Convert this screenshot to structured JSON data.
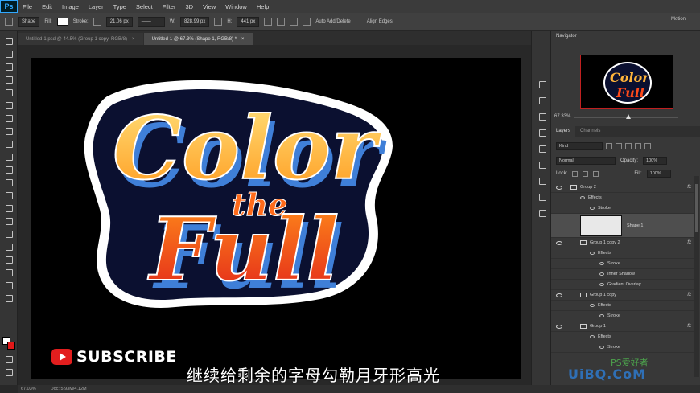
{
  "menu": {
    "app_logo": "Ps",
    "items": [
      "File",
      "Edit",
      "Image",
      "Layer",
      "Type",
      "Select",
      "Filter",
      "3D",
      "View",
      "Window",
      "Help"
    ]
  },
  "options": {
    "mode": "Shape",
    "fill_label": "Fill:",
    "stroke_label": "Stroke:",
    "stroke_width": "21.06 px",
    "width_label": "W:",
    "width_value": "828.99 px",
    "height_label": "H:",
    "height_value": "441 px",
    "auto_add_delete": "Auto Add/Delete",
    "align_edges": "Align Edges",
    "workspace": "Motion"
  },
  "tabs": [
    {
      "label": "Untitled-1.psd @ 44.5% (Group 1 copy, RGB/8)",
      "close": "×"
    },
    {
      "label": "Untitled-1 @ 67.3% (Shape 1, RGB/8) *",
      "close": "×"
    }
  ],
  "artwork": {
    "line1": "Color",
    "line2": "the",
    "line3": "Full",
    "colors": {
      "outline": "#ffffff",
      "dark": "#0b1030",
      "blue": "#3f7fd8",
      "orange": "#ff8a1a",
      "yellow": "#ffd45a",
      "red": "#e8321a"
    }
  },
  "navigator": {
    "title": "Navigator",
    "zoom": "67.33%",
    "preview_line1": "Color",
    "preview_line2": "Full",
    "zoom_fraction": 0.52
  },
  "layers_panel": {
    "tabs": [
      "Layers",
      "Channels"
    ],
    "filter_kind": "Kind",
    "blend_mode": "Normal",
    "opacity_label": "Opacity:",
    "opacity": "100%",
    "lock_label": "Lock:",
    "fill_label": "Fill:",
    "fill": "100%",
    "layers": [
      {
        "name": "Group 2",
        "type": "group",
        "indent": 0,
        "fx": true
      },
      {
        "name": "Effects",
        "type": "effect",
        "indent": 1
      },
      {
        "name": "Stroke",
        "type": "effect",
        "indent": 2
      },
      {
        "name": "Shape 1",
        "type": "shape",
        "indent": 1
      },
      {
        "name": "Group 1 copy 2",
        "type": "group",
        "indent": 1,
        "fx": true
      },
      {
        "name": "Effects",
        "type": "effect",
        "indent": 2
      },
      {
        "name": "Stroke",
        "type": "effect",
        "indent": 3
      },
      {
        "name": "Inner Shadow",
        "type": "effect",
        "indent": 3
      },
      {
        "name": "Gradient Overlay",
        "type": "effect",
        "indent": 3
      },
      {
        "name": "Group 1 copy",
        "type": "group",
        "indent": 1,
        "fx": true
      },
      {
        "name": "Effects",
        "type": "effect",
        "indent": 2
      },
      {
        "name": "Stroke",
        "type": "effect",
        "indent": 3
      },
      {
        "name": "Group 1",
        "type": "group",
        "indent": 1,
        "fx": true
      },
      {
        "name": "Effects",
        "type": "effect",
        "indent": 2
      },
      {
        "name": "Stroke",
        "type": "effect",
        "indent": 3
      }
    ]
  },
  "status": {
    "zoom": "67.03%",
    "doc": "Doc: 5.93M/4.12M"
  },
  "overlay": {
    "subscribe": "SUBSCRIBE",
    "subtitle": "继续给剩余的字母勾勒月牙形高光",
    "watermark": "UiBQ.CoM",
    "watermark_cn": "PS爱好者"
  }
}
